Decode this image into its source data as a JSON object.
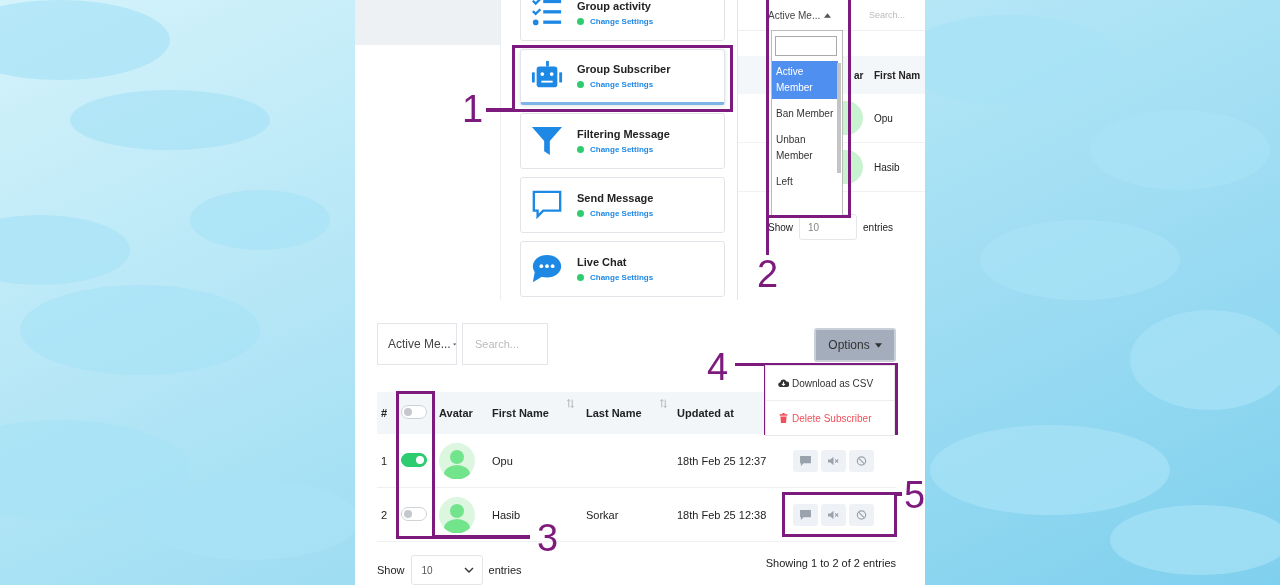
{
  "menu_cards": [
    {
      "kind": "list",
      "title": "Group activity",
      "link": "Change Settings",
      "selected": false
    },
    {
      "kind": "robot",
      "title": "Group Subscriber",
      "link": "Change Settings",
      "selected": true
    },
    {
      "kind": "funnel",
      "title": "Filtering Message",
      "link": "Change Settings",
      "selected": false
    },
    {
      "kind": "message",
      "title": "Send Message",
      "link": "Change Settings",
      "selected": false
    },
    {
      "kind": "chat",
      "title": "Live Chat",
      "link": "Change Settings",
      "selected": false
    }
  ],
  "dropdown_preview": {
    "select_value": "Active Me...",
    "search_placeholder": "Search...",
    "columns": [
      "ar",
      "First Nam"
    ],
    "rows": [
      "Opu",
      "Hasib"
    ],
    "show_label": "Show",
    "page_size": "10",
    "entries_label": "entries",
    "options": [
      {
        "label": "Active Member",
        "selected": true
      },
      {
        "label": "Ban Member",
        "selected": false
      },
      {
        "label": "Unban Member",
        "selected": false
      },
      {
        "label": "Left",
        "selected": false
      }
    ]
  },
  "toolbar": {
    "filter": "Active Me...",
    "search_placeholder": "Search...",
    "options_button": "Options",
    "options_menu": [
      {
        "kind": "download",
        "label": "Download as CSV"
      },
      {
        "kind": "delete",
        "label": "Delete Subscriber"
      }
    ]
  },
  "table": {
    "header_toggle": {
      "on": false
    },
    "columns": [
      {
        "label": "#",
        "sortable": false
      },
      {
        "label": "Avatar",
        "sortable": false
      },
      {
        "label": "First Name",
        "sortable": true
      },
      {
        "label": "Last Name",
        "sortable": true
      },
      {
        "label": "Updated at",
        "sortable": false
      }
    ],
    "rows": [
      {
        "index": "1",
        "active": true,
        "first_name": "Opu",
        "updated": "18th Feb 25 12:37"
      },
      {
        "index": "2",
        "active": false,
        "first_name": "Hasib",
        "last_name": "Sorkar",
        "updated": "18th Feb 25 12:38"
      }
    ]
  },
  "footer": {
    "show_label": "Show",
    "page_size": "10",
    "entries_label": "entries",
    "summary": "Showing 1 to 2 of 2 entries"
  },
  "annotations": [
    {
      "number": "1"
    },
    {
      "number": "2"
    },
    {
      "number": "3"
    },
    {
      "number": "4"
    },
    {
      "number": "5"
    }
  ]
}
